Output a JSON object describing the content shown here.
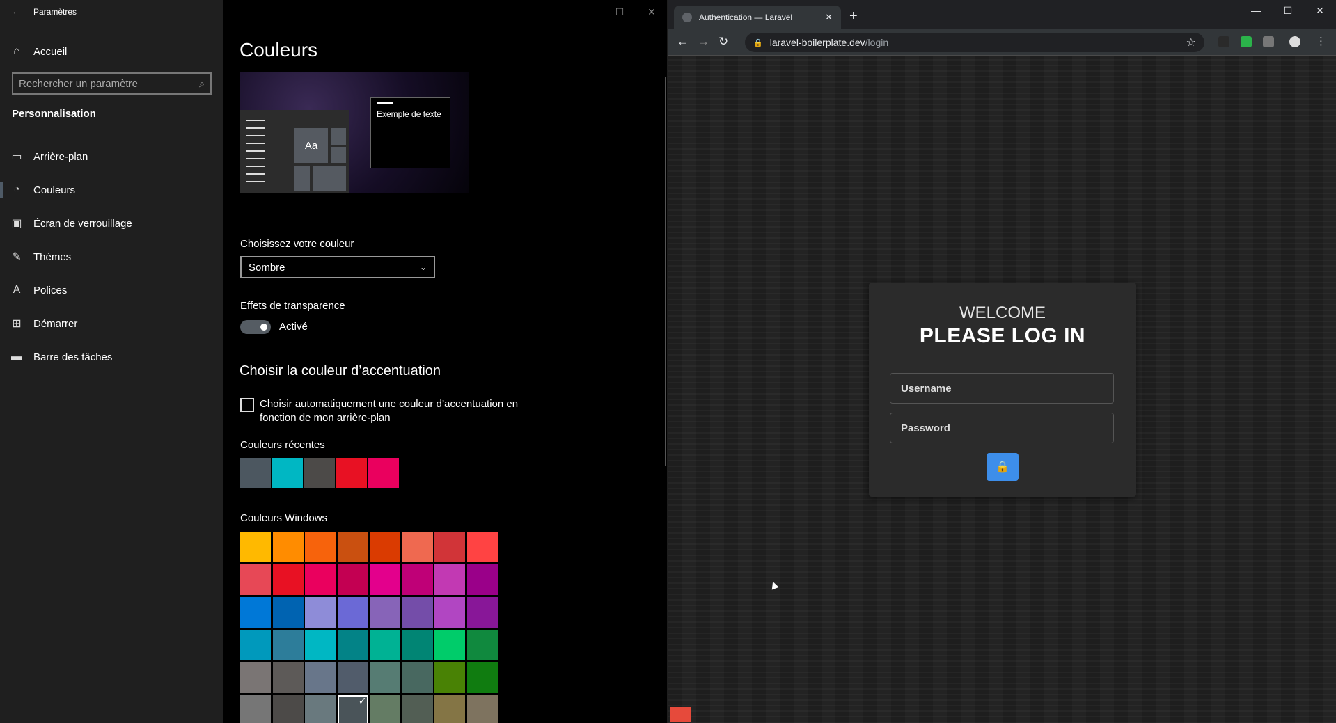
{
  "settings": {
    "window_title": "Paramètres",
    "search_placeholder": "Rechercher un paramètre",
    "home_label": "Accueil",
    "section_label": "Personnalisation",
    "nav": [
      {
        "label": "Arrière-plan",
        "icon": "picture-icon"
      },
      {
        "label": "Couleurs",
        "icon": "palette-icon"
      },
      {
        "label": "Écran de verrouillage",
        "icon": "lock-screen-icon"
      },
      {
        "label": "Thèmes",
        "icon": "brush-icon"
      },
      {
        "label": "Polices",
        "icon": "font-icon"
      },
      {
        "label": "Démarrer",
        "icon": "start-icon"
      },
      {
        "label": "Barre des tâches",
        "icon": "taskbar-icon"
      }
    ],
    "page_title": "Couleurs",
    "preview_text": "Exemple de texte",
    "preview_tile_text": "Aa",
    "choose_color_label": "Choisissez votre couleur",
    "choose_color_value": "Sombre",
    "transparency_label": "Effets de transparence",
    "transparency_state": "Activé",
    "accent_heading": "Choisir la couleur d’accentuation",
    "auto_accent_line1": "Choisir automatiquement une couleur d’accentuation en",
    "auto_accent_line2": "fonction de mon arrière-plan",
    "recent_label": "Couleurs récentes",
    "recent_colors": [
      "#4c5760",
      "#00b7c3",
      "#4c4a48",
      "#e81123",
      "#ea005e"
    ],
    "windows_label": "Couleurs Windows",
    "windows_colors": [
      [
        "#ffb900",
        "#ff8c00",
        "#f7630c",
        "#ca5010",
        "#da3b01",
        "#ef6950",
        "#d13438",
        "#ff4343"
      ],
      [
        "#e74856",
        "#e81123",
        "#ea005e",
        "#c30052",
        "#e3008c",
        "#bf0077",
        "#c239b3",
        "#9a0089"
      ],
      [
        "#0078d7",
        "#0063b1",
        "#8e8cd8",
        "#6b69d6",
        "#8764b8",
        "#744da9",
        "#b146c2",
        "#881798"
      ],
      [
        "#0099bc",
        "#2d7d9a",
        "#00b7c3",
        "#038387",
        "#00b294",
        "#018574",
        "#00cc6a",
        "#10893e"
      ],
      [
        "#7a7574",
        "#5d5a58",
        "#68768a",
        "#515c6b",
        "#567c73",
        "#486860",
        "#498205",
        "#107c10"
      ],
      [
        "#767676",
        "#4c4a48",
        "#69797e",
        "#4a5459",
        "#647c64",
        "#525e54",
        "#847545",
        "#7e735f"
      ]
    ],
    "selected_color": "#4a5459"
  },
  "browser": {
    "tab_title": "Authentication — Laravel",
    "url_host": "laravel-boilerplate.dev",
    "url_path": "/login",
    "welcome": "WELCOME",
    "please_login": "PLEASE LOG IN",
    "username_placeholder": "Username",
    "password_placeholder": "Password",
    "accent": "#3d8eea"
  }
}
